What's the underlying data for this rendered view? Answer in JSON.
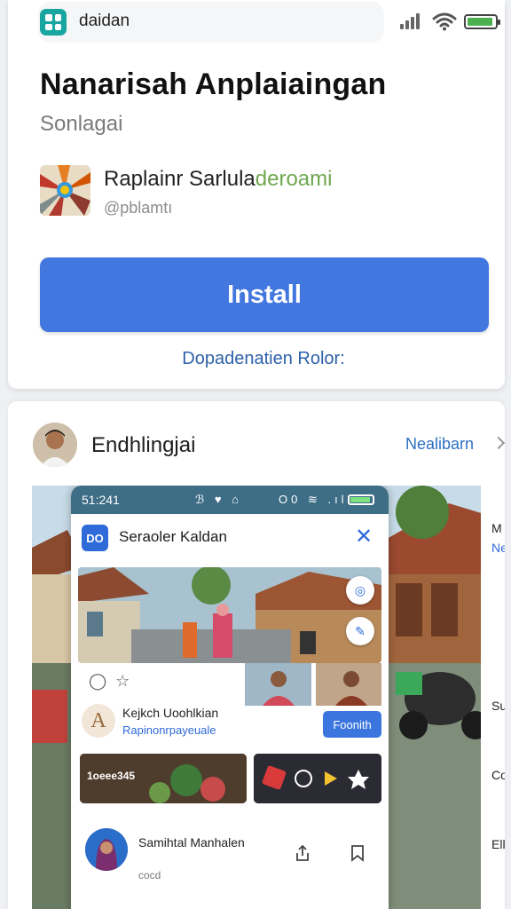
{
  "status_bar": {
    "url_text": "daidan",
    "app_icon": "grid-app-icon",
    "icons": [
      "signal-icon",
      "wifi-icon",
      "battery-icon"
    ]
  },
  "app": {
    "title": "Nanarisah Anplaiaingan",
    "subtitle": "Sonlagai",
    "developer_name_main": "Raplainr Sarlula",
    "developer_name_accent": "deroami",
    "developer_handle": "@pblamtı",
    "install_label": "Install",
    "dependencies_link": "Dopadenatien Rolor:"
  },
  "review": {
    "author_name": "Endhlingjai",
    "nav_link": "Nealibarn",
    "screenshot": {
      "phone_time": "51:241",
      "status_icons_left": "ℬ ♥ ⌂",
      "status_icons_right": "O0 ≋ .ıl",
      "header_icon_text": "DO",
      "header_title": "Seraoler Kaldan",
      "user_mark": "A",
      "user_name": "Kejkch Uoohlkian",
      "user_sub": "Rapinonrpayeuale",
      "action_button": "Foonith",
      "card_left_text": "1oeee345",
      "comment_name": "Samihtal  Manhalen",
      "comment_time": "cocd",
      "side_labels": [
        "M",
        "Ne",
        "Su",
        "Cor",
        "Ell"
      ]
    }
  },
  "colors": {
    "install_button": "#4377e0",
    "link_blue": "#2e62a8",
    "accent_green": "#6fa84e"
  }
}
